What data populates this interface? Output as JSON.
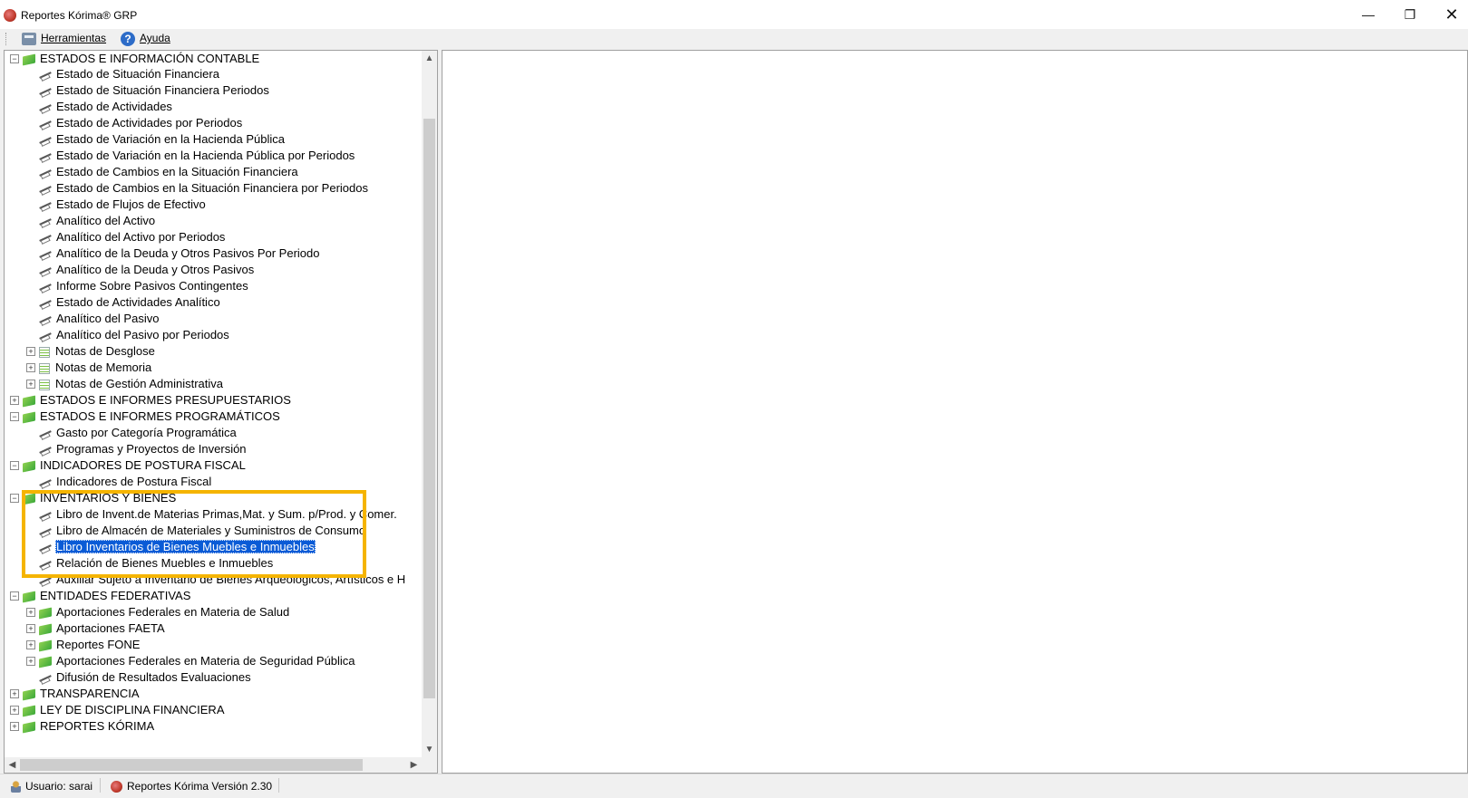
{
  "window": {
    "title": "Reportes Kórima® GRP",
    "minimize": "—",
    "maximize": "❐",
    "close": "✕"
  },
  "menu": {
    "herramientas": "Herramientas",
    "ayuda": "Ayuda"
  },
  "tree": {
    "estados_contable": "ESTADOS E INFORMACIÓN CONTABLE",
    "contable_items": [
      "Estado de Situación Financiera",
      "Estado de Situación Financiera Periodos",
      "Estado de Actividades",
      "Estado de Actividades por Periodos",
      "Estado de Variación en la Hacienda Pública",
      "Estado de Variación en la Hacienda Pública por Periodos",
      "Estado de Cambios en la Situación Financiera",
      "Estado de Cambios en la Situación Financiera por Periodos",
      "Estado de Flujos de Efectivo",
      "Analítico del Activo",
      "Analítico del Activo por Periodos",
      "Analítico de la Deuda y Otros Pasivos Por Periodo",
      "Analítico de la Deuda y Otros Pasivos",
      "Informe Sobre Pasivos Contingentes",
      "Estado de Actividades Analítico",
      "Analítico del Pasivo",
      "Analítico del Pasivo por Periodos"
    ],
    "notas": [
      "Notas de Desglose",
      "Notas de Memoria",
      "Notas de Gestión Administrativa"
    ],
    "presupuestarios": "ESTADOS E INFORMES PRESUPUESTARIOS",
    "programaticos": "ESTADOS E INFORMES PROGRAMÁTICOS",
    "programaticos_items": [
      "Gasto por Categoría Programática",
      "Programas y Proyectos de Inversión"
    ],
    "postura": "INDICADORES DE POSTURA FISCAL",
    "postura_items": [
      "Indicadores de Postura Fiscal"
    ],
    "inventarios": "INVENTARIOS Y BIENES",
    "inventarios_items": [
      "Libro de Invent.de Materias Primas,Mat. y Sum. p/Prod. y Comer.",
      "Libro de Almacén de Materiales y Suministros de Consumo",
      "Libro Inventarios de Bienes Muebles e Inmuebles",
      "Relación de Bienes Muebles e Inmuebles",
      "Auxiliar Sujeto a Inventario de Bienes Arqueológicos, Artísticos e H"
    ],
    "federativas": "ENTIDADES FEDERATIVAS",
    "federativas_items": [
      "Aportaciones Federales en Materia de Salud",
      "Aportaciones FAETA",
      "Reportes FONE",
      "Aportaciones Federales en Materia de Seguridad Pública",
      "Difusión de Resultados Evaluaciones"
    ],
    "transparencia": "TRANSPARENCIA",
    "ley": "LEY DE DISCIPLINA FINANCIERA",
    "korima": "REPORTES KÓRIMA"
  },
  "status": {
    "user": "Usuario: sarai",
    "version": "Reportes Kórima Versión 2.30"
  },
  "colors": {
    "selection": "#0a5bd6",
    "highlight_box": "#f5b400"
  }
}
